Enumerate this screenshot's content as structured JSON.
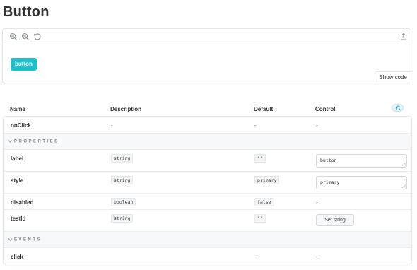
{
  "page": {
    "title": "Button"
  },
  "preview": {
    "toolbar": {
      "icons": [
        "zoom-in-icon",
        "zoom-out-icon",
        "reset-zoom-icon",
        "share-icon"
      ]
    },
    "demo_button_label": "button",
    "show_code_label": "Show code"
  },
  "table": {
    "headers": {
      "name": "Name",
      "description": "Description",
      "default": "Default",
      "control": "Control"
    },
    "reset_icon": "reset-icon",
    "rows": {
      "onClick": {
        "name": "onClick",
        "description": "-",
        "default": "-",
        "control": "-"
      },
      "properties_section": "PROPERTIES",
      "label": {
        "name": "label",
        "type": "string",
        "default": "\"\"",
        "control_value": "button"
      },
      "style": {
        "name": "style",
        "type": "string",
        "default": "primary",
        "control_value": "primary"
      },
      "disabled": {
        "name": "disabled",
        "type": "boolean",
        "default": "false",
        "control": "-"
      },
      "testId": {
        "name": "testId",
        "type": "string",
        "default": "\"\"",
        "control_button": "Set string"
      },
      "events_section": "EVENTS",
      "click": {
        "name": "click",
        "description": "",
        "default": "-",
        "control": "-"
      }
    }
  },
  "colors": {
    "accent": "#1ec0cc",
    "border": "#e3e6ea",
    "section_bg": "#f6f8f9"
  }
}
